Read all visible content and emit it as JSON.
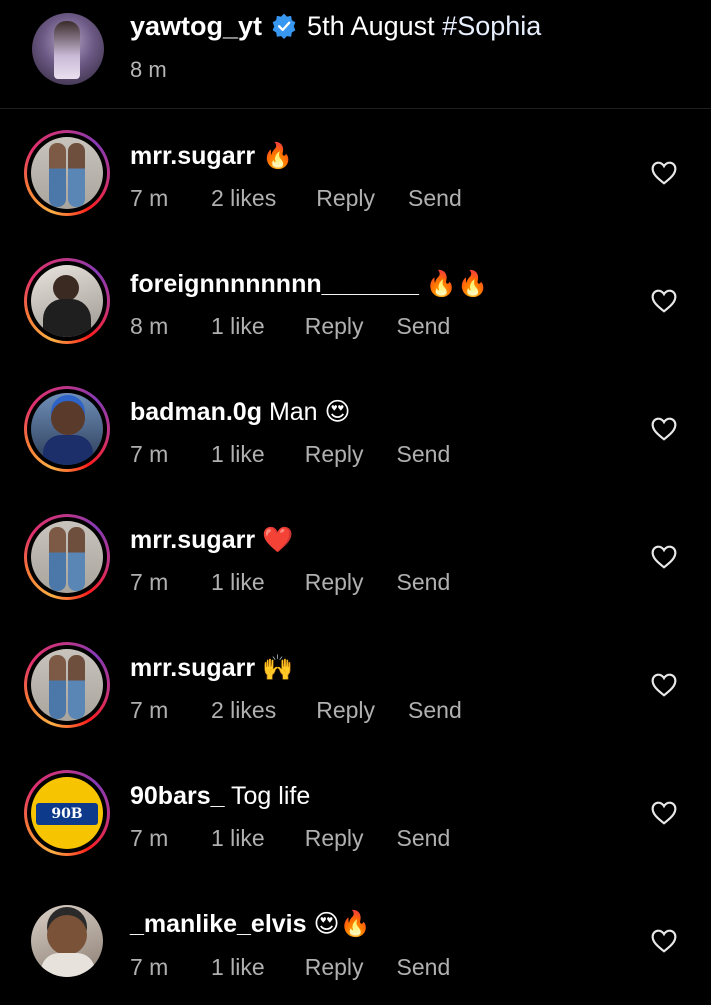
{
  "caption": {
    "username": "yawtog_yt",
    "text": "5th August",
    "hashtag": "#Sophia",
    "time": "8 m",
    "verified_icon": "verified-badge-icon",
    "verified_color": "#3897f0"
  },
  "comments": [
    {
      "username": "mrr.sugarr",
      "text": "",
      "emoji": "🔥",
      "time": "7 m",
      "likes": "2 likes",
      "reply": "Reply",
      "send": "Send"
    },
    {
      "username": "foreignnnnnnnn_______",
      "text": "",
      "emoji": "🔥🔥",
      "time": "8 m",
      "likes": "1 like",
      "reply": "Reply",
      "send": "Send"
    },
    {
      "username": "badman.0g",
      "text": "Man",
      "emoji": "😍",
      "time": "7 m",
      "likes": "1 like",
      "reply": "Reply",
      "send": "Send"
    },
    {
      "username": "mrr.sugarr",
      "text": "",
      "emoji": "❤️",
      "time": "7 m",
      "likes": "1 like",
      "reply": "Reply",
      "send": "Send"
    },
    {
      "username": "mrr.sugarr",
      "text": "",
      "emoji": "🙌",
      "time": "7 m",
      "likes": "2 likes",
      "reply": "Reply",
      "send": "Send"
    },
    {
      "username": "90bars_",
      "text": "Tog life",
      "emoji": "",
      "time": "7 m",
      "likes": "1 like",
      "reply": "Reply",
      "send": "Send",
      "avatar_logo": "90B"
    },
    {
      "username": "_manlike_elvis",
      "text": "",
      "emoji": "😍🔥",
      "time": "7 m",
      "likes": "1 like",
      "reply": "Reply",
      "send": "Send"
    }
  ],
  "colors": {
    "background": "#000000",
    "text": "#ffffff",
    "meta_text": "#b0b0b0",
    "story_ring": [
      "#fcaf45",
      "#f77737",
      "#e1306c",
      "#c13584",
      "#833ab4"
    ]
  },
  "icons": {
    "like": "heart-outline-icon"
  }
}
